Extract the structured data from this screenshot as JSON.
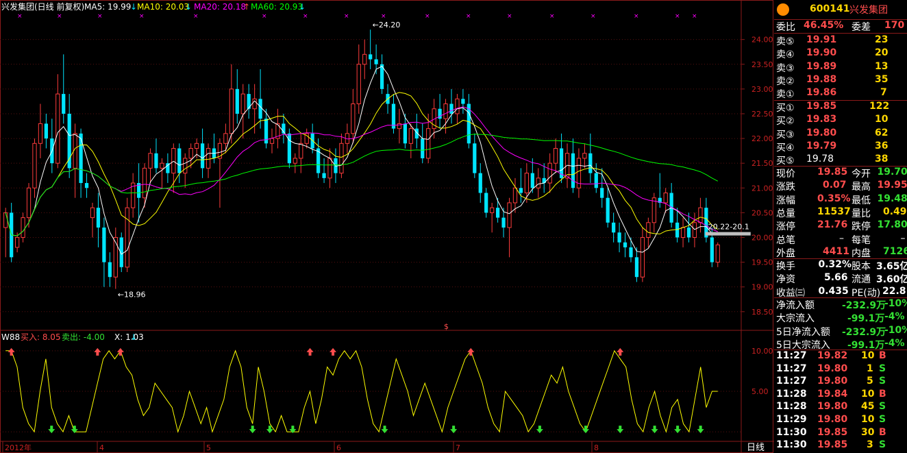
{
  "header": {
    "title": "兴发集团(日线 前复权)",
    "ma": [
      {
        "label": "MA5: 19.99",
        "color": "#ffffff"
      },
      {
        "label": "MA10: 20.03",
        "color": "#ffff00"
      },
      {
        "label": "MA20: 20.18",
        "color": "#ff00ff"
      },
      {
        "label": "MA60: 20.93",
        "color": "#00ff00"
      }
    ]
  },
  "indicator_header": {
    "name": "W88",
    "buy_label": "买入: 8.05",
    "sell_label": "卖出: -4.00",
    "x_label": "X: 1.03"
  },
  "period_label": "日线",
  "colors": {
    "up": "#ff3c3c",
    "down": "#00e5ff",
    "grid": "#8b1a1a"
  },
  "chart_data": [
    {
      "type": "candlestick",
      "yticks": [
        "24.00",
        "23.50",
        "23.00",
        "22.50",
        "22.00",
        "21.50",
        "21.00",
        "20.50",
        "20.00",
        "19.50",
        "19.00",
        "18.50"
      ],
      "ylim": [
        18.4,
        24.3
      ],
      "xlabels": [
        "2012年",
        "4",
        "5",
        "6",
        "7",
        "8"
      ],
      "annotations": [
        {
          "text": "24.20",
          "value": 24.2
        },
        {
          "text": "18.96",
          "value": 18.96
        },
        {
          "text": "20.22-20.1",
          "value": 20.22
        }
      ],
      "candles": [
        [
          20.2,
          20.6,
          19.6,
          20.5
        ],
        [
          20.5,
          20.7,
          19.5,
          19.6
        ],
        [
          19.8,
          20.1,
          19.7,
          20.0
        ],
        [
          20.0,
          20.5,
          19.9,
          20.4
        ],
        [
          20.4,
          21.1,
          20.2,
          21.0
        ],
        [
          21.0,
          22.0,
          20.8,
          21.9
        ],
        [
          21.9,
          22.7,
          21.6,
          22.3
        ],
        [
          22.3,
          22.5,
          21.8,
          22.0
        ],
        [
          22.0,
          22.4,
          21.3,
          21.5
        ],
        [
          21.5,
          23.3,
          21.4,
          22.9
        ],
        [
          22.9,
          23.7,
          22.3,
          22.5
        ],
        [
          22.5,
          22.9,
          21.2,
          21.4
        ],
        [
          21.4,
          22.3,
          20.8,
          22.1
        ],
        [
          22.1,
          22.2,
          20.8,
          21.1
        ],
        [
          21.1,
          21.3,
          20.8,
          21.0
        ],
        [
          20.4,
          20.7,
          20.0,
          20.6
        ],
        [
          20.6,
          20.9,
          19.8,
          20.2
        ],
        [
          20.2,
          20.4,
          19.0,
          19.5
        ],
        [
          19.5,
          19.7,
          19.0,
          19.2
        ],
        [
          19.2,
          20.2,
          18.96,
          20.0
        ],
        [
          20.0,
          20.1,
          19.3,
          19.4
        ],
        [
          19.4,
          20.8,
          19.3,
          20.6
        ],
        [
          20.6,
          21.3,
          20.4,
          21.1
        ],
        [
          21.1,
          21.5,
          20.3,
          20.8
        ],
        [
          20.8,
          21.5,
          20.6,
          21.4
        ],
        [
          21.4,
          21.8,
          21.1,
          21.7
        ],
        [
          21.7,
          22.0,
          21.3,
          21.4
        ],
        [
          21.4,
          21.6,
          21.0,
          21.5
        ],
        [
          21.5,
          21.7,
          21.1,
          21.3
        ],
        [
          21.3,
          21.9,
          20.9,
          21.8
        ],
        [
          21.8,
          21.9,
          21.1,
          21.3
        ],
        [
          21.3,
          21.7,
          21.0,
          21.6
        ],
        [
          21.6,
          21.9,
          21.4,
          21.8
        ],
        [
          21.8,
          22.0,
          21.6,
          21.9
        ],
        [
          21.9,
          22.2,
          21.2,
          21.4
        ],
        [
          21.4,
          21.9,
          21.2,
          21.8
        ],
        [
          21.8,
          22.1,
          21.5,
          21.6
        ],
        [
          21.6,
          22.0,
          20.6,
          21.9
        ],
        [
          21.9,
          22.3,
          21.7,
          22.1
        ],
        [
          22.1,
          23.5,
          21.9,
          23.0
        ],
        [
          23.0,
          23.4,
          22.3,
          22.5
        ],
        [
          22.5,
          23.1,
          22.0,
          22.9
        ],
        [
          22.9,
          23.1,
          22.4,
          22.6
        ],
        [
          22.6,
          23.1,
          22.1,
          22.8
        ],
        [
          22.8,
          23.4,
          22.2,
          22.4
        ],
        [
          22.4,
          22.6,
          21.8,
          21.9
        ],
        [
          21.9,
          22.2,
          21.7,
          22.0
        ],
        [
          22.0,
          22.6,
          21.8,
          22.3
        ],
        [
          22.3,
          22.5,
          21.9,
          22.1
        ],
        [
          22.1,
          22.2,
          21.4,
          21.5
        ],
        [
          21.5,
          21.7,
          21.3,
          21.6
        ],
        [
          21.6,
          22.1,
          21.3,
          21.9
        ],
        [
          21.9,
          22.2,
          21.8,
          22.1
        ],
        [
          22.1,
          22.3,
          21.7,
          21.8
        ],
        [
          21.8,
          22.0,
          21.2,
          21.3
        ],
        [
          21.3,
          21.6,
          21.1,
          21.2
        ],
        [
          21.2,
          21.8,
          21.0,
          21.6
        ],
        [
          21.6,
          21.8,
          21.1,
          21.3
        ],
        [
          21.3,
          22.1,
          21.2,
          21.9
        ],
        [
          21.9,
          22.3,
          21.7,
          22.1
        ],
        [
          22.1,
          23.0,
          21.9,
          22.7
        ],
        [
          22.7,
          23.9,
          22.5,
          23.5
        ],
        [
          23.5,
          24.0,
          23.2,
          23.7
        ],
        [
          23.7,
          24.2,
          23.4,
          23.6
        ],
        [
          23.6,
          23.9,
          23.3,
          23.5
        ],
        [
          23.5,
          23.7,
          22.9,
          23.0
        ],
        [
          22.9,
          23.1,
          22.5,
          22.7
        ],
        [
          22.7,
          22.9,
          22.1,
          22.2
        ],
        [
          22.2,
          22.6,
          21.9,
          22.3
        ],
        [
          22.3,
          22.5,
          21.8,
          21.9
        ],
        [
          21.9,
          22.3,
          21.6,
          22.2
        ],
        [
          22.2,
          22.5,
          21.8,
          22.0
        ],
        [
          22.0,
          22.3,
          21.5,
          21.6
        ],
        [
          21.6,
          22.5,
          21.5,
          22.2
        ],
        [
          22.2,
          22.8,
          22.0,
          22.6
        ],
        [
          22.6,
          22.9,
          22.2,
          22.4
        ],
        [
          22.4,
          22.8,
          22.1,
          22.7
        ],
        [
          22.7,
          23.0,
          22.3,
          22.5
        ],
        [
          22.5,
          22.9,
          22.3,
          22.8
        ],
        [
          22.8,
          23.0,
          22.5,
          22.7
        ],
        [
          22.7,
          22.9,
          21.8,
          21.9
        ],
        [
          21.9,
          22.1,
          21.2,
          21.3
        ],
        [
          21.3,
          21.5,
          20.7,
          20.9
        ],
        [
          20.9,
          21.0,
          20.4,
          20.5
        ],
        [
          20.5,
          20.7,
          20.1,
          20.6
        ],
        [
          20.6,
          20.8,
          20.3,
          20.4
        ],
        [
          20.4,
          20.6,
          20.0,
          20.2
        ],
        [
          20.2,
          20.8,
          19.6,
          20.7
        ],
        [
          20.7,
          21.2,
          20.5,
          21.0
        ],
        [
          21.0,
          21.4,
          20.7,
          20.9
        ],
        [
          20.9,
          21.5,
          20.7,
          21.3
        ],
        [
          21.3,
          21.6,
          20.9,
          21.0
        ],
        [
          21.0,
          21.4,
          20.8,
          21.2
        ],
        [
          21.2,
          21.5,
          20.9,
          21.1
        ],
        [
          21.1,
          21.7,
          20.9,
          21.5
        ],
        [
          21.5,
          22.0,
          21.3,
          21.8
        ],
        [
          21.8,
          22.1,
          21.1,
          21.2
        ],
        [
          21.2,
          21.9,
          21.0,
          21.7
        ],
        [
          21.7,
          22.0,
          20.9,
          21.0
        ],
        [
          21.0,
          21.8,
          20.8,
          21.6
        ],
        [
          21.6,
          21.9,
          21.4,
          21.7
        ],
        [
          21.7,
          22.1,
          21.1,
          21.3
        ],
        [
          21.3,
          21.5,
          20.9,
          21.0
        ],
        [
          21.0,
          21.4,
          20.6,
          20.8
        ],
        [
          20.8,
          21.0,
          20.2,
          20.3
        ],
        [
          20.3,
          20.5,
          19.9,
          20.1
        ],
        [
          20.1,
          20.3,
          19.7,
          19.9
        ],
        [
          19.9,
          20.1,
          19.6,
          19.8
        ],
        [
          19.8,
          20.0,
          19.5,
          19.6
        ],
        [
          19.6,
          19.8,
          19.1,
          19.2
        ],
        [
          19.2,
          20.2,
          19.1,
          20.0
        ],
        [
          20.0,
          20.4,
          19.8,
          20.3
        ],
        [
          20.3,
          20.9,
          20.1,
          20.8
        ],
        [
          20.8,
          21.3,
          20.6,
          20.7
        ],
        [
          20.7,
          21.0,
          20.5,
          20.9
        ],
        [
          20.9,
          21.1,
          20.2,
          20.3
        ],
        [
          20.3,
          20.6,
          19.9,
          20.0
        ],
        [
          20.0,
          20.4,
          19.8,
          20.2
        ],
        [
          20.2,
          20.5,
          19.9,
          20.0
        ],
        [
          20.0,
          20.5,
          19.8,
          20.3
        ],
        [
          20.3,
          20.8,
          20.1,
          20.6
        ],
        [
          20.6,
          20.8,
          19.9,
          20.0
        ],
        [
          20.0,
          20.2,
          19.4,
          19.5
        ],
        [
          19.5,
          19.9,
          19.4,
          19.85
        ]
      ],
      "series": [
        {
          "name": "MA5",
          "color": "#ffffff"
        },
        {
          "name": "MA10",
          "color": "#ffff00"
        },
        {
          "name": "MA20",
          "color": "#ff00ff"
        },
        {
          "name": "MA60",
          "color": "#00ff00"
        }
      ]
    },
    {
      "type": "line",
      "yticks": [
        "10.00",
        "5.00"
      ],
      "ylim": [
        -0.5,
        11
      ],
      "series": [
        {
          "name": "W88",
          "color": "#ffff00",
          "values": [
            10,
            10,
            8,
            3,
            1,
            0,
            5,
            9,
            3,
            1,
            0,
            2,
            0,
            0,
            0,
            3,
            6,
            9,
            10,
            9,
            10,
            8,
            7,
            4,
            2,
            3,
            6,
            5,
            4,
            3,
            0,
            2,
            5,
            3,
            1,
            3,
            0,
            2,
            4,
            8,
            10,
            8,
            3,
            1,
            8,
            5,
            1,
            0,
            2,
            0,
            0,
            0,
            3,
            5,
            1,
            4,
            8,
            7,
            9,
            10,
            9,
            10,
            8,
            4,
            1,
            0,
            3,
            6,
            9,
            7,
            5,
            2,
            4,
            6,
            4,
            2,
            0,
            3,
            5,
            7,
            9,
            10,
            8,
            6,
            3,
            1,
            0,
            5,
            4,
            3,
            2,
            0,
            1,
            3,
            5,
            7,
            6,
            8,
            5,
            3,
            1,
            0,
            2,
            4,
            6,
            8,
            10,
            9,
            8,
            4,
            1,
            0,
            3,
            5,
            2,
            0,
            3,
            4,
            1,
            0,
            4,
            8,
            3,
            5,
            5
          ]
        }
      ],
      "buy_signals": [
        1,
        16,
        20,
        53,
        57,
        81,
        107
      ],
      "sell_signals": [
        8,
        12,
        43,
        46,
        50,
        66,
        78,
        93,
        101,
        107,
        113,
        117,
        121
      ]
    }
  ],
  "quote": {
    "code": "600141",
    "name": "兴发集团",
    "webi_label": "委比",
    "webi_value": "46.45%",
    "weicha_label": "委差",
    "weicha_value": "170",
    "sell": [
      {
        "label": "卖⑤",
        "price": "19.91",
        "vol": "23"
      },
      {
        "label": "卖④",
        "price": "19.90",
        "vol": "20"
      },
      {
        "label": "卖③",
        "price": "19.89",
        "vol": "13"
      },
      {
        "label": "卖②",
        "price": "19.88",
        "vol": "35"
      },
      {
        "label": "卖①",
        "price": "19.86",
        "vol": "7"
      }
    ],
    "buy": [
      {
        "label": "买①",
        "price": "19.85",
        "vol": "122"
      },
      {
        "label": "买②",
        "price": "19.83",
        "vol": "10"
      },
      {
        "label": "买③",
        "price": "19.80",
        "vol": "62"
      },
      {
        "label": "买④",
        "price": "19.79",
        "vol": "36"
      },
      {
        "label": "买⑤",
        "price": "19.78",
        "vol": "38"
      }
    ],
    "stats": [
      {
        "l1": "现价",
        "v1": "19.85",
        "c1": "red",
        "l2": "今开",
        "v2": "19.70",
        "c2": "grn"
      },
      {
        "l1": "涨跌",
        "v1": "0.07",
        "c1": "red",
        "l2": "最高",
        "v2": "19.95",
        "c2": "red"
      },
      {
        "l1": "涨幅",
        "v1": "0.35%",
        "c1": "red",
        "l2": "最低",
        "v2": "19.48",
        "c2": "grn"
      },
      {
        "l1": "总量",
        "v1": "11537",
        "c1": "yel",
        "l2": "量比",
        "v2": "0.49",
        "c2": "yel"
      },
      {
        "l1": "涨停",
        "v1": "21.76",
        "c1": "red",
        "l2": "跌停",
        "v2": "17.80",
        "c2": "grn"
      },
      {
        "l1": "总笔",
        "v1": "–",
        "c1": "wht",
        "l2": "每笔",
        "v2": "–",
        "c2": "wht"
      },
      {
        "l1": "外盘",
        "v1": "4411",
        "c1": "red",
        "l2": "内盘",
        "v2": "7126",
        "c2": "grn"
      }
    ],
    "stats2": [
      {
        "l1": "换手",
        "v1": "0.32%",
        "l2": "股本",
        "v2": "3.65亿"
      },
      {
        "l1": "净资",
        "v1": "5.66",
        "l2": "流通",
        "v2": "3.60亿"
      },
      {
        "l1": "收益㈢",
        "v1": "0.435",
        "l2": "PE(动)",
        "v2": "22.8"
      }
    ],
    "flows": [
      {
        "label": "净流入额",
        "value": "-232.9万",
        "pct": "-10%"
      },
      {
        "label": "大宗流入",
        "value": "-99.1万",
        "pct": "-4%"
      },
      {
        "label": "5日净流入额",
        "value": "-232.9万",
        "pct": "-10%"
      },
      {
        "label": "5日大宗流入",
        "value": "-99.1万",
        "pct": "-4%"
      }
    ],
    "ticks": [
      {
        "time": "11:27",
        "price": "19.82",
        "vol": "10",
        "side": "B"
      },
      {
        "time": "11:27",
        "price": "19.80",
        "vol": "1",
        "side": "S"
      },
      {
        "time": "11:27",
        "price": "19.80",
        "vol": "5",
        "side": "S"
      },
      {
        "time": "11:28",
        "price": "19.84",
        "vol": "10",
        "side": "B"
      },
      {
        "time": "11:28",
        "price": "19.80",
        "vol": "45",
        "side": "S"
      },
      {
        "time": "11:29",
        "price": "19.80",
        "vol": "10",
        "side": "S"
      },
      {
        "time": "11:30",
        "price": "19.85",
        "vol": "30",
        "side": "B"
      },
      {
        "time": "11:30",
        "price": "19.85",
        "vol": "3",
        "side": "S"
      }
    ]
  }
}
